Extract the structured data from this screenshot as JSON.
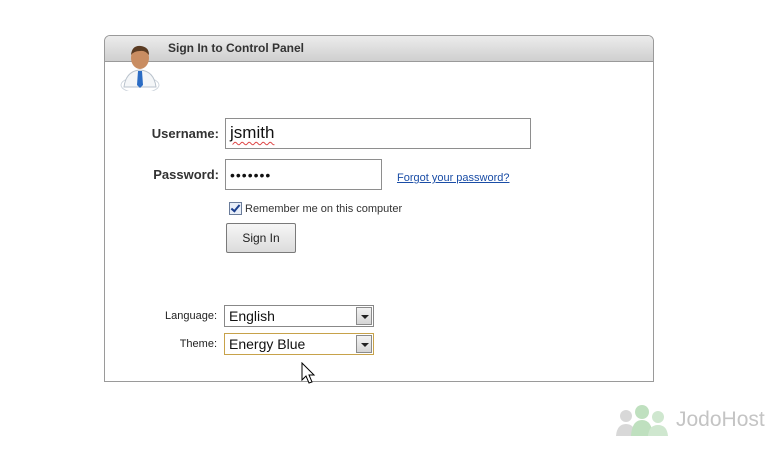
{
  "panel": {
    "title": "Sign In to Control Panel"
  },
  "form": {
    "username_label": "Username:",
    "username_value": "jsmith",
    "password_label": "Password:",
    "password_value": "•••••••",
    "forgot_link": "Forgot your password?",
    "remember_label": "Remember me on this computer",
    "remember_checked": true,
    "signin_button": "Sign In",
    "language_label": "Language:",
    "language_value": "English",
    "theme_label": "Theme:",
    "theme_value": "Energy Blue"
  },
  "brand": {
    "name": "JodoHost"
  },
  "icons": {
    "user": "user-icon",
    "checkbox": "checkbox-checked-icon",
    "dropdown": "chevron-down-icon",
    "cursor": "mouse-cursor-icon",
    "brand": "jodohost-logo-icon"
  },
  "colors": {
    "link": "#1a4da6",
    "header_bg": "#d6d6d6",
    "focus_border": "#c7a24a",
    "brand_text": "#c4c4c4"
  }
}
